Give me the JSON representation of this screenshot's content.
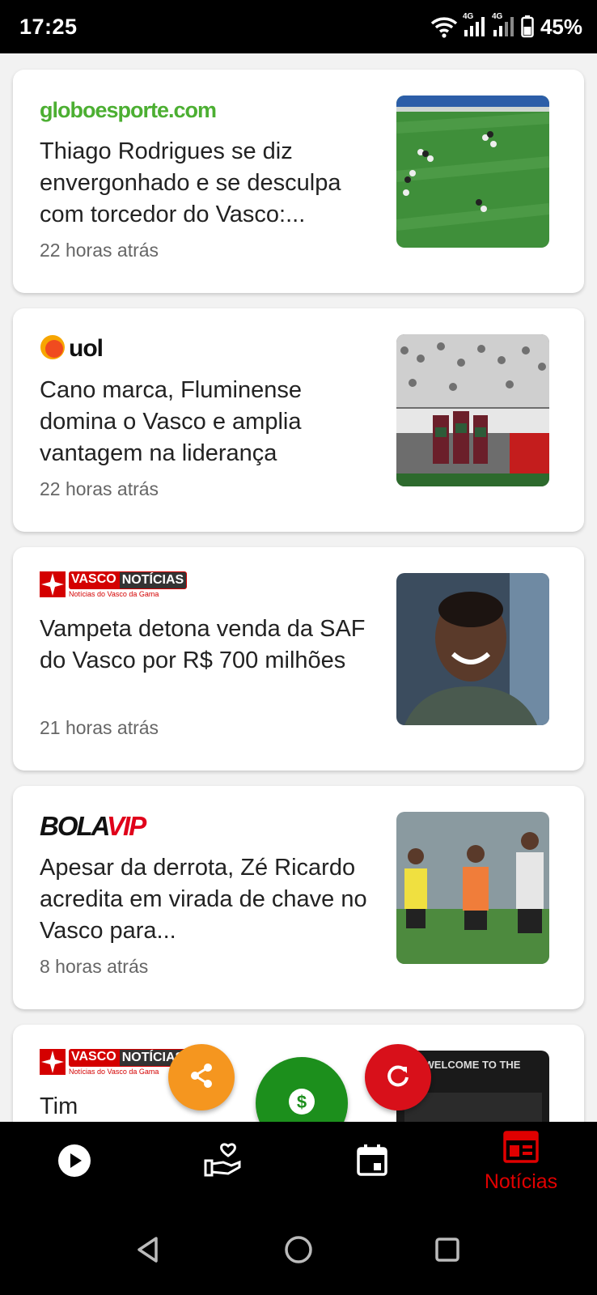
{
  "status_bar": {
    "time": "17:25",
    "network_1": "4G",
    "network_2": "4G",
    "battery": "45%"
  },
  "articles": [
    {
      "source_logo": "globoesporte.com",
      "title": "Thiago Rodrigues se diz envergonhado e se desculpa com torcedor do Vasco:...",
      "time": "22 horas atrás",
      "thumbnail": "soccer-field-aerial"
    },
    {
      "source_logo": "uol",
      "title": "Cano marca, Fluminense domina o Vasco e amplia vantagem na liderança",
      "time": "22 horas atrás",
      "thumbnail": "players-celebrating"
    },
    {
      "source_logo": "VASCO NOTÍCIAS",
      "source_logo_part_a": "VASCO",
      "source_logo_part_b": "NOTÍCIAS",
      "source_logo_sub": "Notícias do Vasco da Gama",
      "title": "Vampeta detona venda da SAF do Vasco por R$ 700 milhões",
      "time": "21 horas atrás",
      "thumbnail": "man-portrait"
    },
    {
      "source_logo": "BOLAVIP",
      "source_logo_part_a": "BOLA",
      "source_logo_part_b": "VIP",
      "title": "Apesar da derrota, Zé Ricardo acredita em virada de chave no Vasco para...",
      "time": "8 horas atrás",
      "thumbnail": "training-session"
    },
    {
      "source_logo": "VASCO NOTÍCIAS",
      "source_logo_part_a": "VASCO",
      "source_logo_part_b": "NOTÍCIAS",
      "source_logo_sub": "Notícias do Vasco da Gama",
      "title": "Tim",
      "time": "",
      "thumbnail": "welcome-to-the-777",
      "thumbnail_text": "WELCOME TO THE"
    }
  ],
  "fabs": {
    "share_icon": "share-icon",
    "money_icon": "dollar-icon",
    "refresh_icon": "refresh-icon"
  },
  "bottom_nav": {
    "items": [
      {
        "icon": "play-icon",
        "label": ""
      },
      {
        "icon": "donate-icon",
        "label": ""
      },
      {
        "icon": "calendar-icon",
        "label": ""
      },
      {
        "icon": "news-icon",
        "label": "Notícias",
        "active": true
      }
    ]
  },
  "colors": {
    "accent_red": "#e00000",
    "share_orange": "#f5961f",
    "money_green": "#1c8f1c",
    "refresh_red": "#d8101a",
    "ge_green": "#4caf32"
  }
}
